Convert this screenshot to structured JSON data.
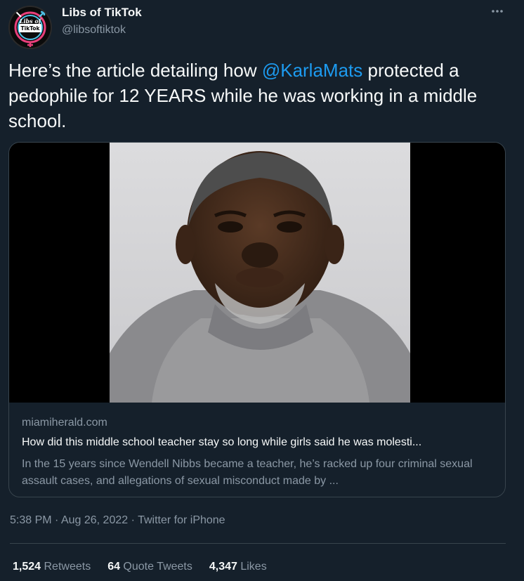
{
  "author": {
    "name": "Libs of TikTok",
    "handle": "@libsoftiktok",
    "avatar_text_top": "Libs of",
    "avatar_text_bottom": "TikTok"
  },
  "tweet": {
    "text_before": "Here’s the article detailing how ",
    "mention": "@KarlaMats",
    "text_after": " protected a pedophile for 12 YEARS while he was working in a middle school."
  },
  "card": {
    "domain": "miamiherald.com",
    "title": "How did this middle school teacher stay so long while girls said he was molesti...",
    "description": "In the 15 years since Wendell Nibbs became a teacher, he’s racked up four criminal sexual assault cases, and allegations of sexual misconduct made by ..."
  },
  "meta": {
    "time": "5:38 PM",
    "sep1": " · ",
    "date": "Aug 26, 2022",
    "sep2": " · ",
    "source": "Twitter for iPhone"
  },
  "stats": {
    "retweets_count": "1,524",
    "retweets_label": " Retweets",
    "quotes_count": "64",
    "quotes_label": " Quote Tweets",
    "likes_count": "4,347",
    "likes_label": " Likes"
  },
  "icons": {
    "more": "more-horizontal-icon"
  },
  "colors": {
    "background": "#15202b",
    "accent": "#1d9bf0",
    "secondary_text": "#8b98a5",
    "border": "#38444d"
  }
}
